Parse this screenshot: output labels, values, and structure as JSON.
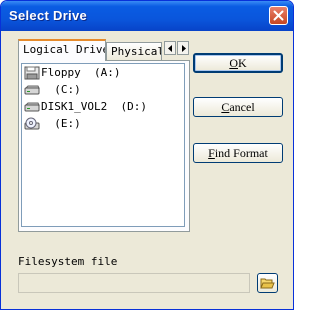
{
  "window": {
    "title": "Select Drive"
  },
  "tabs": [
    {
      "label": "Logical Drive",
      "active": true
    },
    {
      "label": "Physical",
      "active": false
    }
  ],
  "drives": [
    {
      "label": "Floppy  (A:)",
      "icon": "floppy-icon"
    },
    {
      "label": "  (C:)",
      "icon": "hard-drive-icon"
    },
    {
      "label": "DISK1_VOL2  (D:)",
      "icon": "hard-drive-icon"
    },
    {
      "label": "  (E:)",
      "icon": "cd-drive-icon"
    }
  ],
  "buttons": {
    "ok": {
      "pre": "",
      "u": "O",
      "post": "K"
    },
    "cancel": {
      "pre": "",
      "u": "C",
      "post": "ancel"
    },
    "find_format": {
      "pre": "",
      "u": "F",
      "post": "ind Format"
    }
  },
  "filesystem": {
    "label": "Filesystem file",
    "value": ""
  }
}
